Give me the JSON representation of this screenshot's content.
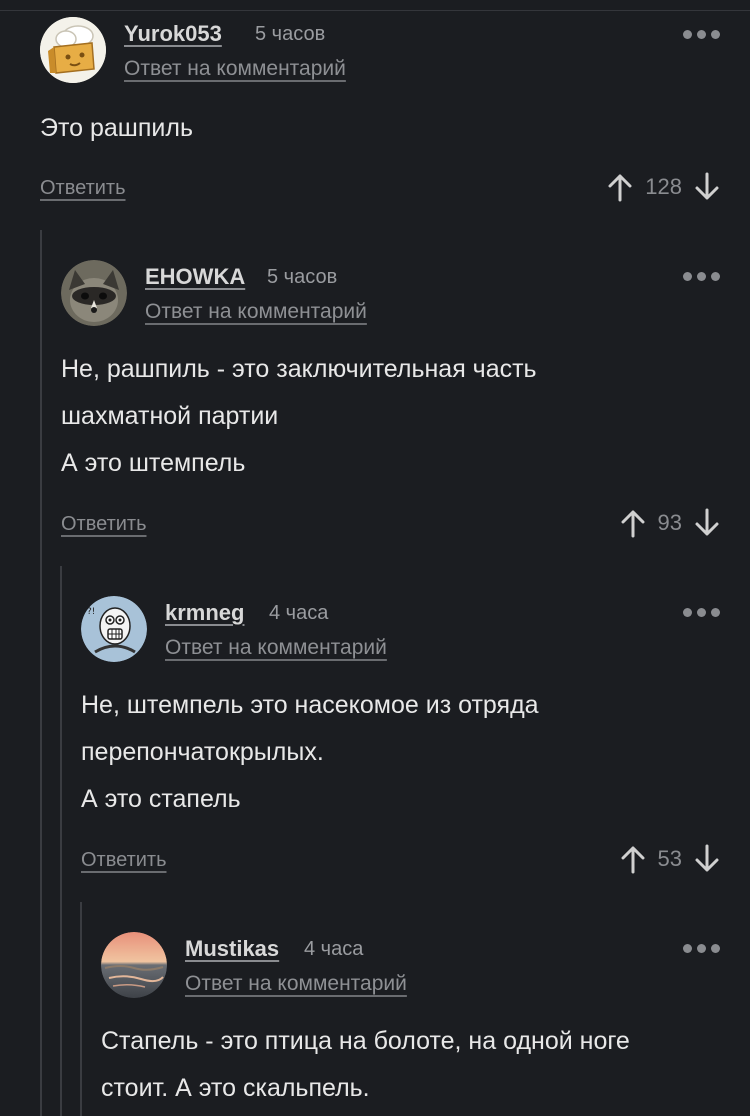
{
  "comments": [
    {
      "username": "Yurok053",
      "time": "5 часов",
      "reply_to": "Ответ на комментарий",
      "lines": [
        "Это рашпиль"
      ],
      "reply_label": "Ответить",
      "votes": "128"
    },
    {
      "username": "EHOWKA",
      "time": "5 часов",
      "reply_to": "Ответ на комментарий",
      "lines": [
        "Не, рашпиль - это заключительная часть",
        "шахматной партии",
        "А это штемпель"
      ],
      "reply_label": "Ответить",
      "votes": "93"
    },
    {
      "username": "krmneg",
      "time": "4 часа",
      "reply_to": "Ответ на комментарий",
      "lines": [
        "Не, штемпель это насекомое из отряда",
        "перепончатокрылых.",
        "А это стапель"
      ],
      "reply_label": "Ответить",
      "votes": "53"
    },
    {
      "username": "Mustikas",
      "time": "4 часа",
      "reply_to": "Ответ на комментарий",
      "lines": [
        "Стапель - это птица на болоте, на одной ноге",
        "стоит. А это скальпель."
      ]
    }
  ],
  "colors": {
    "background": "#1b1d21",
    "muted": "#8a8c90",
    "thread_line": "#3a3c41"
  },
  "icons": {
    "menu": "more-dots-icon",
    "upvote": "arrow-up-icon",
    "downvote": "arrow-down-icon"
  }
}
